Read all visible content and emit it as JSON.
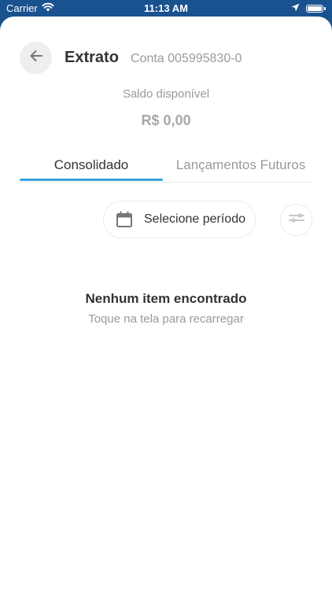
{
  "status_bar": {
    "carrier": "Carrier",
    "time": "11:13 AM"
  },
  "header": {
    "title": "Extrato",
    "account": "Conta 005995830-0"
  },
  "balance": {
    "label": "Saldo disponível",
    "value": "R$ 0,00"
  },
  "tabs": [
    {
      "label": "Consolidado",
      "active": true
    },
    {
      "label": "Lançamentos Futuros",
      "active": false
    }
  ],
  "period": {
    "label": "Selecione período"
  },
  "empty_state": {
    "title": "Nenhum item encontrado",
    "subtitle": "Toque na tela para recarregar"
  },
  "colors": {
    "status_bar_bg": "#19528f",
    "accent": "#3aa0dc",
    "text_primary": "#333333",
    "text_secondary": "#9a9a9a"
  },
  "icons": {
    "back": "arrow-left-icon",
    "calendar": "calendar-icon",
    "filter": "sliders-icon",
    "wifi": "wifi-icon",
    "location": "location-arrow-icon",
    "battery": "battery-icon"
  }
}
